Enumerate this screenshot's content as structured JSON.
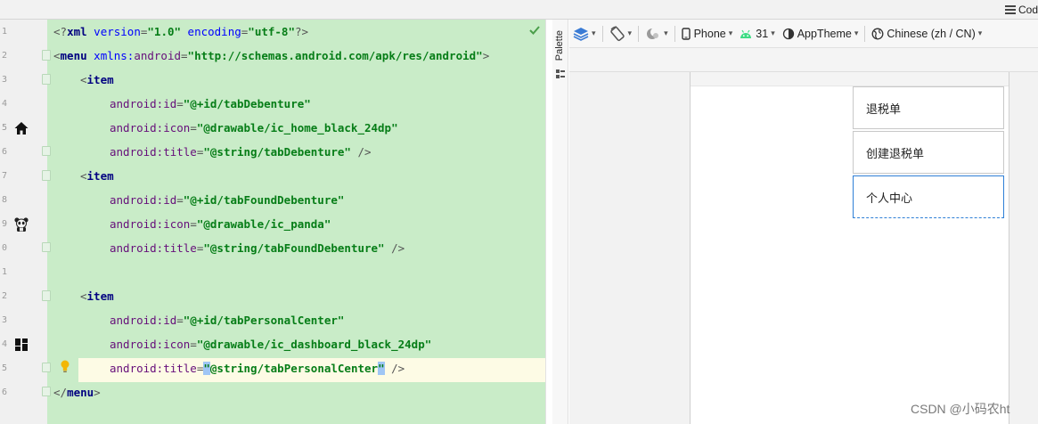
{
  "topbar": {
    "code_label": "Cod"
  },
  "editor": {
    "line_numbers": [
      "1",
      "2",
      "3",
      "4",
      "5",
      "6",
      "7",
      "8",
      "9",
      "0",
      "1",
      "2",
      "3",
      "4",
      "5",
      "6"
    ],
    "code": {
      "l1": {
        "a": "<?",
        "b": "xml",
        "c": " version",
        "d": "=",
        "e": "\"1.0\"",
        "f": " encoding",
        "g": "=",
        "h": "\"utf-8\"",
        "i": "?>"
      },
      "l2": {
        "a": "<",
        "b": "menu",
        "c": " xmlns:",
        "d": "android",
        "e": "=",
        "f": "\"http://schemas.android.com/apk/res/android\"",
        "g": ">"
      },
      "l3": {
        "a": "<",
        "b": "item"
      },
      "l4": {
        "a": "android:id",
        "b": "=",
        "c": "\"@+id/tabDebenture\""
      },
      "l5": {
        "a": "android:icon",
        "b": "=",
        "c": "\"@drawable/ic_home_black_24dp\""
      },
      "l6": {
        "a": "android:title",
        "b": "=",
        "c": "\"@string/tabDebenture\"",
        "d": " />"
      },
      "l7": {
        "a": "<",
        "b": "item"
      },
      "l8": {
        "a": "android:id",
        "b": "=",
        "c": "\"@+id/tabFoundDebenture\""
      },
      "l9": {
        "a": "android:icon",
        "b": "=",
        "c": "\"@drawable/ic_panda\""
      },
      "l10": {
        "a": "android:title",
        "b": "=",
        "c": "\"@string/tabFoundDebenture\"",
        "d": " />"
      },
      "l12": {
        "a": "<",
        "b": "item"
      },
      "l13": {
        "a": "android:id",
        "b": "=",
        "c": "\"@+id/tabPersonalCenter\""
      },
      "l14": {
        "a": "android:icon",
        "b": "=",
        "c": "\"@drawable/ic_dashboard_black_24dp\""
      },
      "l15": {
        "a": "android:title",
        "b": "=",
        "q1": "\"",
        "c": "@string/tabPersonalCenter",
        "q2": "\"",
        "d": " />"
      },
      "l16": {
        "a": "</",
        "b": "menu",
        "c": ">"
      }
    }
  },
  "palette": {
    "label": "Palette"
  },
  "designbar": {
    "device": "Phone",
    "api": "31",
    "theme": "AppTheme",
    "locale": "Chinese (zh / CN)"
  },
  "preview": {
    "items": [
      "退税单",
      "创建退税单",
      "个人中心"
    ]
  },
  "watermark": "CSDN @小码农ht",
  "colors": {
    "code_background": "#c9ecc8",
    "current_line": "#fdfbe5",
    "selection": "#2e7fd6"
  }
}
